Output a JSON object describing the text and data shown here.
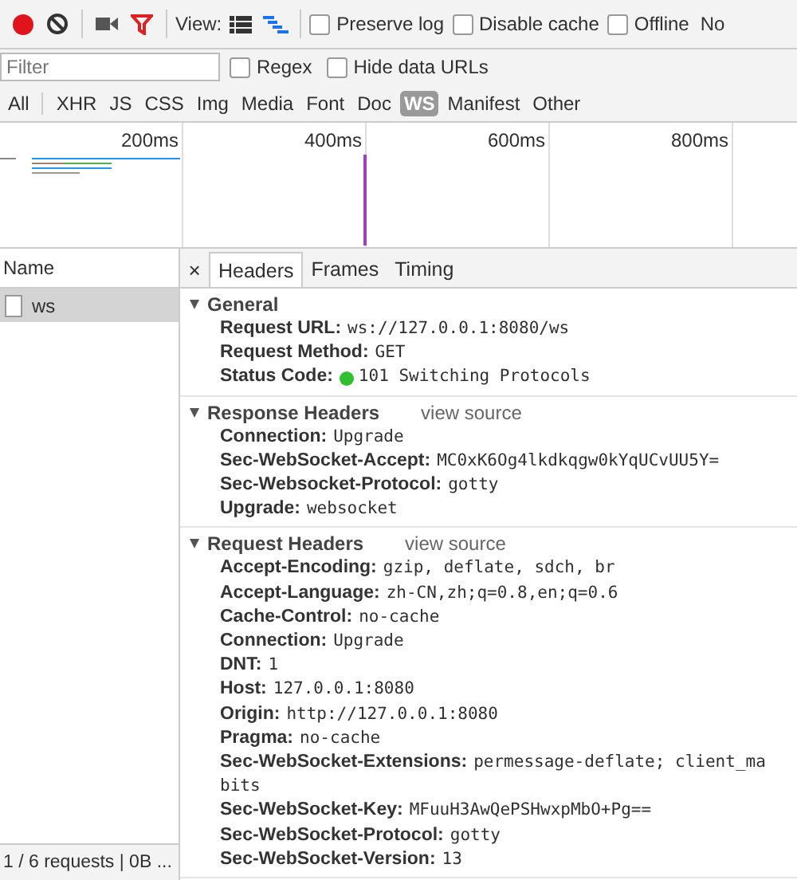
{
  "toolbar": {
    "recording": true,
    "filter_active": true,
    "view_label": "View:",
    "views": [
      {
        "kind": "list",
        "selected": false
      },
      {
        "kind": "waterfall",
        "selected": true
      }
    ],
    "options": [
      {
        "label": "Preserve log",
        "checked": false
      },
      {
        "label": "Disable cache",
        "checked": false
      },
      {
        "label": "Offline",
        "checked": false
      }
    ],
    "throttling": "No"
  },
  "filter": {
    "placeholder": "Filter",
    "options": [
      {
        "label": "Regex",
        "checked": false
      },
      {
        "label": "Hide data URLs",
        "checked": false
      }
    ]
  },
  "types": [
    {
      "label": "All",
      "selected": false
    },
    {
      "label": "XHR",
      "selected": false
    },
    {
      "label": "JS",
      "selected": false
    },
    {
      "label": "CSS",
      "selected": false
    },
    {
      "label": "Img",
      "selected": false
    },
    {
      "label": "Media",
      "selected": false
    },
    {
      "label": "Font",
      "selected": false
    },
    {
      "label": "Doc",
      "selected": false
    },
    {
      "label": "WS",
      "selected": true
    },
    {
      "label": "Manifest",
      "selected": false
    },
    {
      "label": "Other",
      "selected": false
    }
  ],
  "timeline": {
    "ticks": [
      "200ms",
      "400ms",
      "600ms",
      "800ms"
    ]
  },
  "requests": {
    "column": "Name",
    "rows": [
      {
        "name": "ws",
        "selected": true
      }
    ],
    "status": "1 / 6 requests | 0B ..."
  },
  "detail": {
    "close": "×",
    "tabs": [
      {
        "label": "Headers",
        "selected": true
      },
      {
        "label": "Frames",
        "selected": false
      },
      {
        "label": "Timing",
        "selected": false
      }
    ],
    "sections": [
      {
        "title": "General",
        "expanded": true,
        "rows": [
          {
            "key": "Request URL:",
            "value": "ws://127.0.0.1:8080/ws"
          },
          {
            "key": "Request Method:",
            "value": "GET"
          },
          {
            "key": "Status Code:",
            "value": "101 Switching Protocols",
            "color": "#2fbf2f"
          }
        ]
      },
      {
        "title": "Response Headers",
        "expanded": true,
        "link": "view source",
        "rows": [
          {
            "key": "Connection:",
            "value": "Upgrade"
          },
          {
            "key": "Sec-WebSocket-Accept:",
            "value": "MC0xK6Og4lkdkqgw0kYqUCvUU5Y="
          },
          {
            "key": "Sec-Websocket-Protocol:",
            "value": "gotty"
          },
          {
            "key": "Upgrade:",
            "value": "websocket"
          }
        ]
      },
      {
        "title": "Request Headers",
        "expanded": true,
        "link": "view source",
        "rows": [
          {
            "key": "Accept-Encoding:",
            "value": "gzip, deflate, sdch, br"
          },
          {
            "key": "Accept-Language:",
            "value": "zh-CN,zh;q=0.8,en;q=0.6"
          },
          {
            "key": "Cache-Control:",
            "value": "no-cache"
          },
          {
            "key": "Connection:",
            "value": "Upgrade"
          },
          {
            "key": "DNT:",
            "value": "1"
          },
          {
            "key": "Host:",
            "value": "127.0.0.1:8080"
          },
          {
            "key": "Origin:",
            "value": "http://127.0.0.1:8080"
          },
          {
            "key": "Pragma:",
            "value": "no-cache"
          },
          {
            "key": "Sec-WebSocket-Extensions:",
            "value": "permessage-deflate; client_ma",
            "continuation": "bits"
          },
          {
            "key": "Sec-WebSocket-Key:",
            "value": "MFuuH3AwQePSHwxpMbO+Pg=="
          },
          {
            "key": "Sec-WebSocket-Protocol:",
            "value": "gotty"
          },
          {
            "key": "Sec-WebSocket-Version:",
            "value": "13"
          }
        ]
      }
    ]
  }
}
